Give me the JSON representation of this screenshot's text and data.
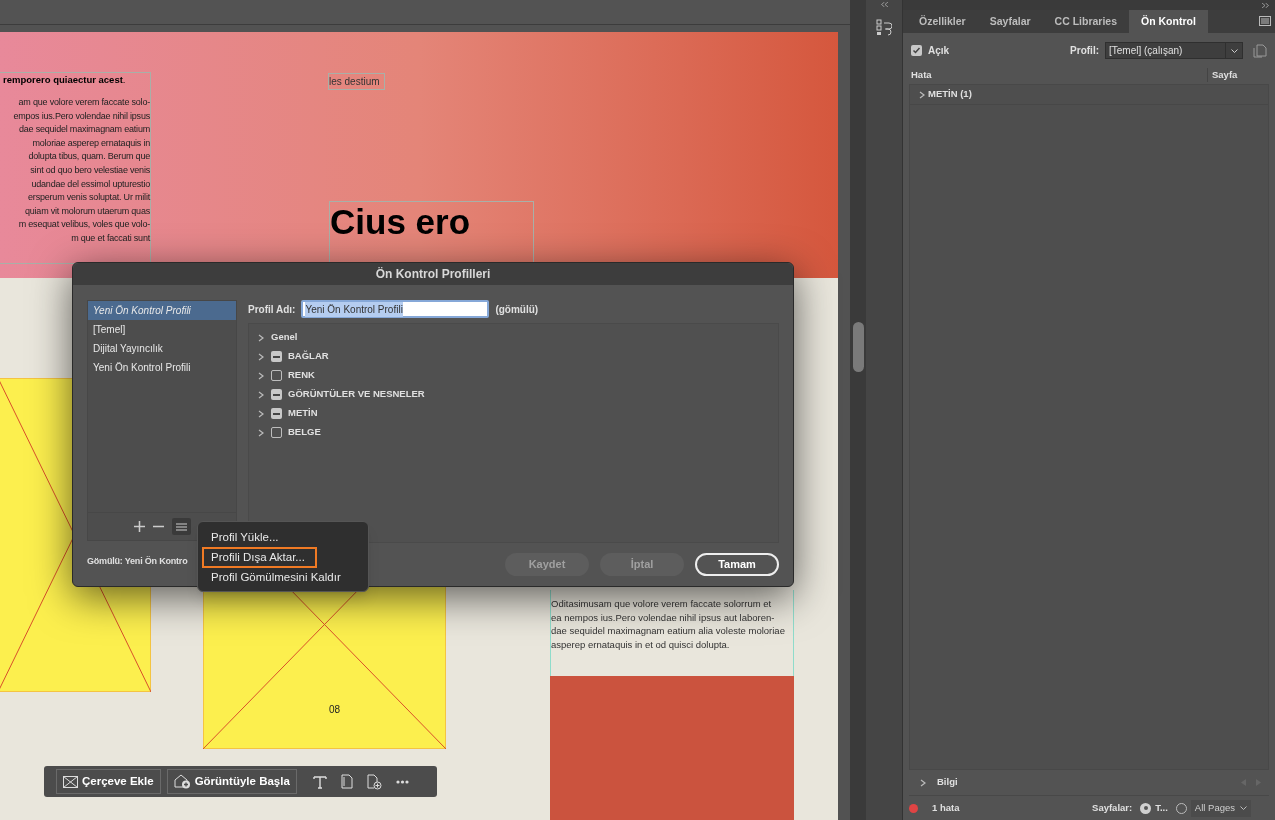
{
  "canvas": {
    "heading": "**remporero quiaectur acest**.",
    "body_lines": [
      "am que volore verem faccate solo-",
      "empos ius.Pero volendae nihil ipsus",
      "dae sequidel maximagnam eatium",
      " moloriae asperep ernataquis in",
      " dolupta tibus, quam. Berum que",
      "sint od quo bero velestiae venis",
      "udandae del essimol upturestio",
      "ersperum venis soluptat. Ur milit",
      " quiam vit molorum utaerum quas",
      "m esequat velibus, voles que volo-",
      "m que et faccati sunt"
    ],
    "caption": "les destium",
    "headline": "Cius ero",
    "right_lines": [
      "Oditasimusam que volore verem faccate solorrum et",
      "ea nempos ius.Pero volendae nihil ipsus aut laboren-",
      "dae sequidel maximagnam eatium alia voleste moloriae",
      "asperep ernataquis in et od quisci dolupta."
    ],
    "page_number": "08"
  },
  "toolbar": {
    "buttons": [
      {
        "label": "Çerçeve Ekle",
        "kind": "frame"
      },
      {
        "label": "Görüntüyle Başla",
        "kind": "image"
      }
    ]
  },
  "dialog": {
    "title": "Ön Kontrol Profilleri",
    "profiles": [
      {
        "label": "Yeni Ön Kontrol Profili",
        "selected": true
      },
      {
        "label": "[Temel]",
        "selected": false
      },
      {
        "label": "Dijital Yayıncılık",
        "selected": false
      },
      {
        "label": "Yeni Ön Kontrol Profili",
        "selected": false
      }
    ],
    "name_label": "Profil Adı:",
    "name_value": "Yeni Ön Kontrol Profili",
    "name_note": "(gömülü)",
    "categories": [
      {
        "label": "Genel",
        "kind": "plain"
      },
      {
        "label": "BAĞLAR",
        "kind": "checkbox",
        "mixed": true
      },
      {
        "label": "RENK",
        "kind": "checkbox",
        "mixed": false
      },
      {
        "label": "GÖRÜNTÜLER VE NESNELER",
        "kind": "checkbox",
        "mixed": true
      },
      {
        "label": "METİN",
        "kind": "checkbox",
        "mixed": true
      },
      {
        "label": "BELGE",
        "kind": "checkbox",
        "mixed": false
      }
    ],
    "embedded_status": "Gömülü: Yeni Ön Kontro",
    "buttons": [
      {
        "label": "Kaydet",
        "disabled": true
      },
      {
        "label": "İptal",
        "disabled": true
      },
      {
        "label": "Tamam",
        "disabled": false
      }
    ],
    "menu": [
      {
        "label": "Profil Yükle...",
        "selected": false
      },
      {
        "label": "Profili Dışa Aktar...",
        "selected": true
      },
      {
        "label": "Profil Gömülmesini Kaldır",
        "selected": false
      }
    ]
  },
  "panel": {
    "tabs": [
      {
        "label": "Özellikler",
        "selected": false
      },
      {
        "label": "Sayfalar",
        "selected": false
      },
      {
        "label": "CC Libraries",
        "selected": false
      },
      {
        "label": "Ön Kontrol",
        "selected": true
      }
    ],
    "enabled": {
      "label": "Açık",
      "checked": true
    },
    "profile_label": "Profil:",
    "profile_value": "[Temel] (çalışan)",
    "columns": [
      "Hata",
      "Sayfa"
    ],
    "errors": [
      {
        "label": "METİN (1)",
        "expanded": false
      }
    ],
    "info": "Bilgi",
    "error_count": "1 hata",
    "pages_label": "Sayfalar:",
    "radios": [
      {
        "label": "T...",
        "selected": true
      },
      {
        "selected": false
      }
    ],
    "page_range": "All Pages"
  }
}
